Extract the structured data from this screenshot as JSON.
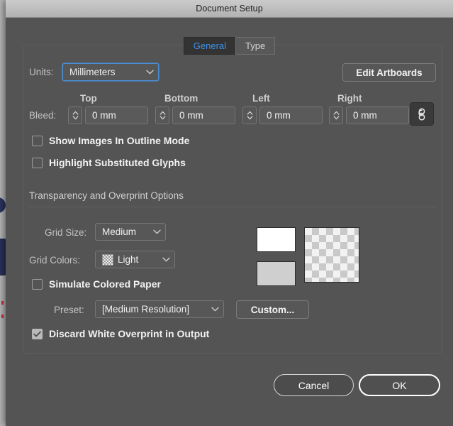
{
  "window": {
    "title": "Document Setup"
  },
  "tabs": [
    {
      "label": "General",
      "selected": true
    },
    {
      "label": "Type",
      "selected": false
    }
  ],
  "general": {
    "units": {
      "label": "Units:",
      "value": "Millimeters",
      "chevron_icon": "chevron-down-icon"
    },
    "edit_artboards_label": "Edit Artboards",
    "bleed": {
      "label": "Bleed:",
      "link_icon": "link-chain-icon",
      "fields": [
        {
          "heading": "Top",
          "value": "0 mm"
        },
        {
          "heading": "Bottom",
          "value": "0 mm"
        },
        {
          "heading": "Left",
          "value": "0 mm"
        },
        {
          "heading": "Right",
          "value": "0 mm"
        }
      ]
    },
    "checkboxes": [
      {
        "label": "Show Images In Outline Mode",
        "checked": false
      },
      {
        "label": "Highlight Substituted Glyphs",
        "checked": false
      }
    ]
  },
  "transparency": {
    "heading": "Transparency and Overprint Options",
    "grid_size": {
      "label": "Grid Size:",
      "value": "Medium"
    },
    "grid_colors": {
      "label": "Grid Colors:",
      "value": "Light",
      "swatch_icon": "checkerboard-swatch-icon"
    },
    "simulate_colored_paper": {
      "label": "Simulate Colored Paper",
      "checked": false
    },
    "preset": {
      "label": "Preset:",
      "value": "[Medium Resolution]"
    },
    "custom_button_label": "Custom...",
    "discard_white_overprint": {
      "label": "Discard White Overprint in Output",
      "checked": true
    },
    "preview": {
      "top_swatch_color": "#ffffff",
      "bottom_swatch_color": "#cfcfcf",
      "checker_label": "transparency-checkerboard"
    }
  },
  "footer": {
    "cancel_label": "Cancel",
    "ok_label": "OK"
  },
  "colors": {
    "dialog_bg": "#545454",
    "titlebar_bg": "#bdbdbd",
    "accent_blue": "#3c93e8",
    "text_primary": "#f2f2f2",
    "text_secondary": "#c2c2c2"
  }
}
